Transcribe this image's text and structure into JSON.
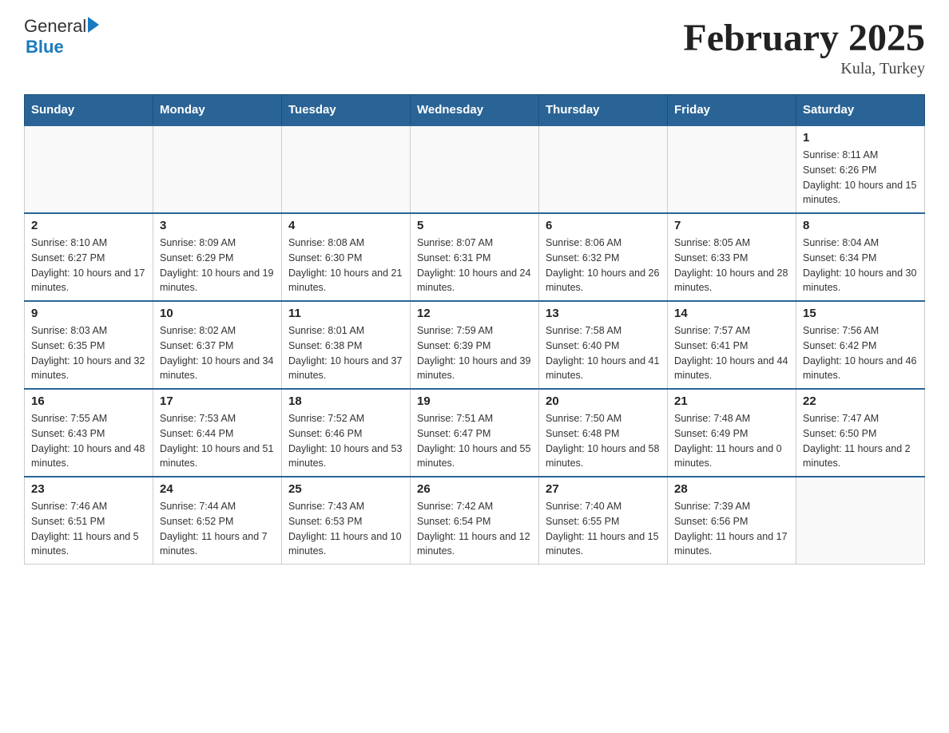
{
  "header": {
    "logo_general": "General",
    "logo_blue": "Blue",
    "title": "February 2025",
    "subtitle": "Kula, Turkey"
  },
  "days_of_week": [
    "Sunday",
    "Monday",
    "Tuesday",
    "Wednesday",
    "Thursday",
    "Friday",
    "Saturday"
  ],
  "weeks": [
    [
      {
        "day": "",
        "info": ""
      },
      {
        "day": "",
        "info": ""
      },
      {
        "day": "",
        "info": ""
      },
      {
        "day": "",
        "info": ""
      },
      {
        "day": "",
        "info": ""
      },
      {
        "day": "",
        "info": ""
      },
      {
        "day": "1",
        "info": "Sunrise: 8:11 AM\nSunset: 6:26 PM\nDaylight: 10 hours and 15 minutes."
      }
    ],
    [
      {
        "day": "2",
        "info": "Sunrise: 8:10 AM\nSunset: 6:27 PM\nDaylight: 10 hours and 17 minutes."
      },
      {
        "day": "3",
        "info": "Sunrise: 8:09 AM\nSunset: 6:29 PM\nDaylight: 10 hours and 19 minutes."
      },
      {
        "day": "4",
        "info": "Sunrise: 8:08 AM\nSunset: 6:30 PM\nDaylight: 10 hours and 21 minutes."
      },
      {
        "day": "5",
        "info": "Sunrise: 8:07 AM\nSunset: 6:31 PM\nDaylight: 10 hours and 24 minutes."
      },
      {
        "day": "6",
        "info": "Sunrise: 8:06 AM\nSunset: 6:32 PM\nDaylight: 10 hours and 26 minutes."
      },
      {
        "day": "7",
        "info": "Sunrise: 8:05 AM\nSunset: 6:33 PM\nDaylight: 10 hours and 28 minutes."
      },
      {
        "day": "8",
        "info": "Sunrise: 8:04 AM\nSunset: 6:34 PM\nDaylight: 10 hours and 30 minutes."
      }
    ],
    [
      {
        "day": "9",
        "info": "Sunrise: 8:03 AM\nSunset: 6:35 PM\nDaylight: 10 hours and 32 minutes."
      },
      {
        "day": "10",
        "info": "Sunrise: 8:02 AM\nSunset: 6:37 PM\nDaylight: 10 hours and 34 minutes."
      },
      {
        "day": "11",
        "info": "Sunrise: 8:01 AM\nSunset: 6:38 PM\nDaylight: 10 hours and 37 minutes."
      },
      {
        "day": "12",
        "info": "Sunrise: 7:59 AM\nSunset: 6:39 PM\nDaylight: 10 hours and 39 minutes."
      },
      {
        "day": "13",
        "info": "Sunrise: 7:58 AM\nSunset: 6:40 PM\nDaylight: 10 hours and 41 minutes."
      },
      {
        "day": "14",
        "info": "Sunrise: 7:57 AM\nSunset: 6:41 PM\nDaylight: 10 hours and 44 minutes."
      },
      {
        "day": "15",
        "info": "Sunrise: 7:56 AM\nSunset: 6:42 PM\nDaylight: 10 hours and 46 minutes."
      }
    ],
    [
      {
        "day": "16",
        "info": "Sunrise: 7:55 AM\nSunset: 6:43 PM\nDaylight: 10 hours and 48 minutes."
      },
      {
        "day": "17",
        "info": "Sunrise: 7:53 AM\nSunset: 6:44 PM\nDaylight: 10 hours and 51 minutes."
      },
      {
        "day": "18",
        "info": "Sunrise: 7:52 AM\nSunset: 6:46 PM\nDaylight: 10 hours and 53 minutes."
      },
      {
        "day": "19",
        "info": "Sunrise: 7:51 AM\nSunset: 6:47 PM\nDaylight: 10 hours and 55 minutes."
      },
      {
        "day": "20",
        "info": "Sunrise: 7:50 AM\nSunset: 6:48 PM\nDaylight: 10 hours and 58 minutes."
      },
      {
        "day": "21",
        "info": "Sunrise: 7:48 AM\nSunset: 6:49 PM\nDaylight: 11 hours and 0 minutes."
      },
      {
        "day": "22",
        "info": "Sunrise: 7:47 AM\nSunset: 6:50 PM\nDaylight: 11 hours and 2 minutes."
      }
    ],
    [
      {
        "day": "23",
        "info": "Sunrise: 7:46 AM\nSunset: 6:51 PM\nDaylight: 11 hours and 5 minutes."
      },
      {
        "day": "24",
        "info": "Sunrise: 7:44 AM\nSunset: 6:52 PM\nDaylight: 11 hours and 7 minutes."
      },
      {
        "day": "25",
        "info": "Sunrise: 7:43 AM\nSunset: 6:53 PM\nDaylight: 11 hours and 10 minutes."
      },
      {
        "day": "26",
        "info": "Sunrise: 7:42 AM\nSunset: 6:54 PM\nDaylight: 11 hours and 12 minutes."
      },
      {
        "day": "27",
        "info": "Sunrise: 7:40 AM\nSunset: 6:55 PM\nDaylight: 11 hours and 15 minutes."
      },
      {
        "day": "28",
        "info": "Sunrise: 7:39 AM\nSunset: 6:56 PM\nDaylight: 11 hours and 17 minutes."
      },
      {
        "day": "",
        "info": ""
      }
    ]
  ]
}
